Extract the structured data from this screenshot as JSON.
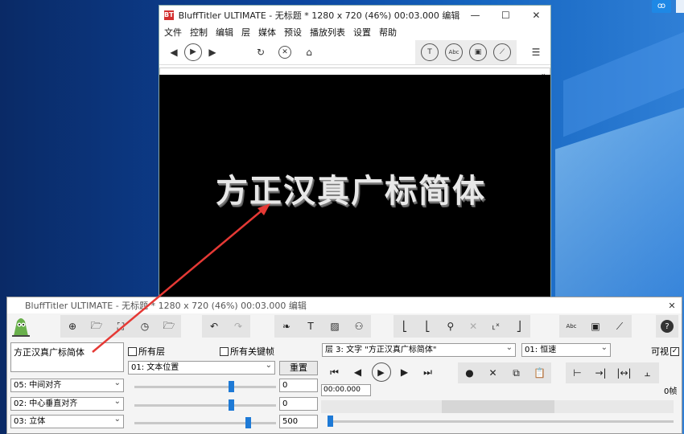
{
  "desktop": {
    "tray_badge": "ꝏ"
  },
  "preview_window": {
    "logo": "BT",
    "title": "BluffTitler ULTIMATE  - 无标题 * 1280 x 720 (46%) 00:03.000 编辑",
    "menu": [
      "文件",
      "控制",
      "编辑",
      "层",
      "媒体",
      "预设",
      "播放列表",
      "设置",
      "帮助"
    ],
    "preview_text": "方正汉真广标简体"
  },
  "editor_window": {
    "title": "BluffTitler ULTIMATE  - 无标题 * 1280 x 720 (46%) 00:03.000 编辑",
    "text_value": "方正汉真广标简体",
    "all_layers_label": "所有层",
    "all_keyframes_label": "所有关键帧",
    "layer_select": "层 3: 文字 \"方正汉真广标简体\"",
    "speed_select": "01: 恒速",
    "visible_label": "可视",
    "property_select": "01: 文本位置",
    "reset_label": "重置",
    "align_h": "05: 中间对齐",
    "align_v": "02: 中心垂直对齐",
    "style_select": "03: 立体",
    "value1": "0",
    "value2": "0",
    "value3": "500",
    "time_value": "00:00.000",
    "frame_label": "0帧",
    "slider_levels": [
      0.68,
      0.68,
      0.8
    ],
    "timeline_position": 0.0
  }
}
